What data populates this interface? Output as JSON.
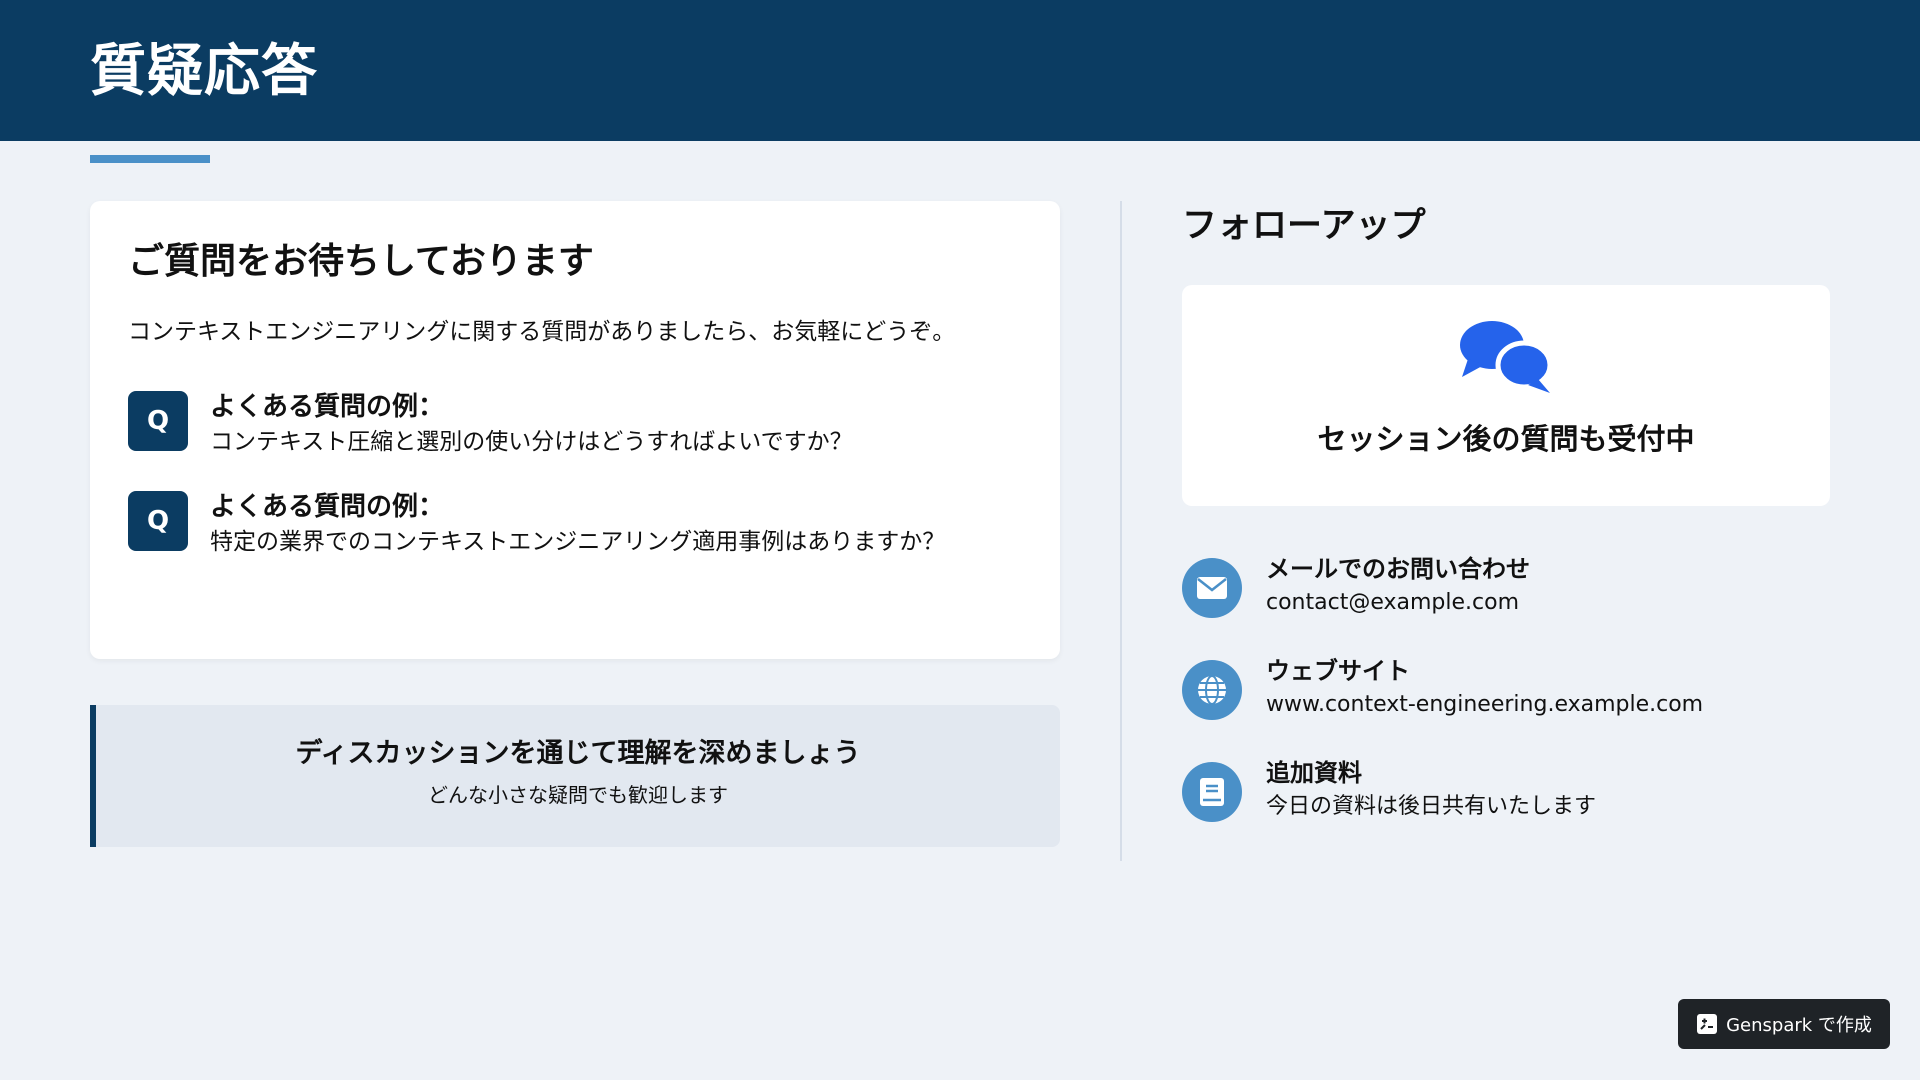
{
  "header": {
    "title": "質疑応答"
  },
  "left_card": {
    "title": "ご質問をお待ちしております",
    "intro": "コンテキストエンジニアリングに関する質問がありましたら、お気軽にどうぞ。",
    "items": [
      {
        "icon_letter": "Q",
        "label": "よくある質問の例：",
        "question": "コンテキスト圧縮と選別の使い分けはどうすればよいですか？"
      },
      {
        "icon_letter": "Q",
        "label": "よくある質問の例：",
        "question": "特定の業界でのコンテキストエンジニアリング適用事例はありますか？"
      }
    ]
  },
  "discussion": {
    "title": "ディスカッションを通じて理解を深めましょう",
    "subtitle": "どんな小さな疑問でも歓迎します"
  },
  "followup": {
    "title": "フォローアップ",
    "card_icon": "chat-bubbles-icon",
    "card_text": "セッション後の質問も受付中",
    "contacts": [
      {
        "icon": "envelope-icon",
        "label": "メールでのお問い合わせ",
        "value": "contact@example.com"
      },
      {
        "icon": "globe-icon",
        "label": "ウェブサイト",
        "value": "www.context-engineering.example.com"
      },
      {
        "icon": "book-icon",
        "label": "追加資料",
        "value": "今日の資料は後日共有いたします"
      }
    ]
  },
  "badge": {
    "icon": "genspark-icon",
    "text": "Genspark で作成"
  },
  "colors": {
    "header_bg": "#0b3c62",
    "accent": "#4a90c8",
    "page_bg": "#eef2f7",
    "chat_icon": "#2563eb"
  }
}
